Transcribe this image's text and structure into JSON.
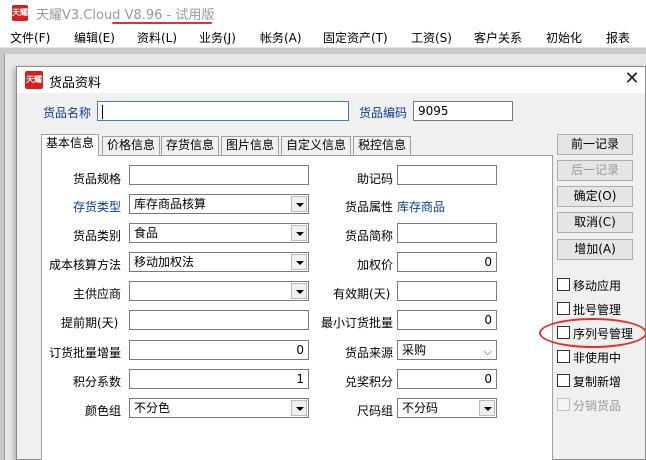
{
  "app": {
    "logo_text": "天耀",
    "title_prefix": "天耀V3.Cloud ",
    "version": "V8.96 - 试用版"
  },
  "menu": [
    "文件(F)",
    "编辑(E)",
    "资料(L)",
    "业务(J)",
    "帐务(A)",
    "固定资产(T)",
    "工资(S)",
    "客户关系",
    "初始化",
    "报表"
  ],
  "dialog": {
    "title": "货品资料",
    "logo_text": "天耀",
    "close_glyph": "✕",
    "name_label": "货品名称",
    "name_value": "",
    "code_label": "货品编码",
    "code_value": "9095"
  },
  "tabs": [
    "基本信息",
    "价格信息",
    "存货信息",
    "图片信息",
    "自定义信息",
    "税控信息"
  ],
  "form": {
    "spec_label": "货品规格",
    "spec_value": "",
    "memo_label": "助记码",
    "memo_value": "",
    "stock_type_label": "存货类型",
    "stock_type_value": "库存商品核算",
    "attr_label": "货品属性",
    "attr_value": "库存商品",
    "category_label": "货品类别",
    "category_value": "食品",
    "short_label": "货品简称",
    "short_value": "",
    "cost_label": "成本核算方法",
    "cost_value": "移动加权法",
    "wprice_label": "加权价",
    "wprice_value": "0",
    "supplier_label": "主供应商",
    "supplier_value": "",
    "valid_label": "有效期(天)",
    "valid_value": "",
    "lead_label": "提前期(天)",
    "lead_value": "",
    "minbatch_label": "最小订货批量",
    "minbatch_value": "0",
    "inc_label": "订货批量增量",
    "inc_value": "0",
    "source_label": "货品来源",
    "source_value": "采购",
    "points_label": "积分系数",
    "points_value": "1",
    "redeem_label": "兑奖积分",
    "redeem_value": "0",
    "color_label": "颜色组",
    "color_value": "不分色",
    "size_label": "尺码组",
    "size_value": "不分码"
  },
  "buttons": {
    "prev": "前一记录",
    "next": "后一记录",
    "ok": "确定(O)",
    "cancel": "取消(C)",
    "add": "增加(A)"
  },
  "checkboxes": {
    "mobile": "移动应用",
    "batch": "批号管理",
    "serial": "序列号管理",
    "inactive": "非使用中",
    "copy_new": "复制新增",
    "distribute": "分销货品"
  },
  "colors": {
    "accent_red": "#e0312b",
    "label_blue": "#0b3d91"
  }
}
